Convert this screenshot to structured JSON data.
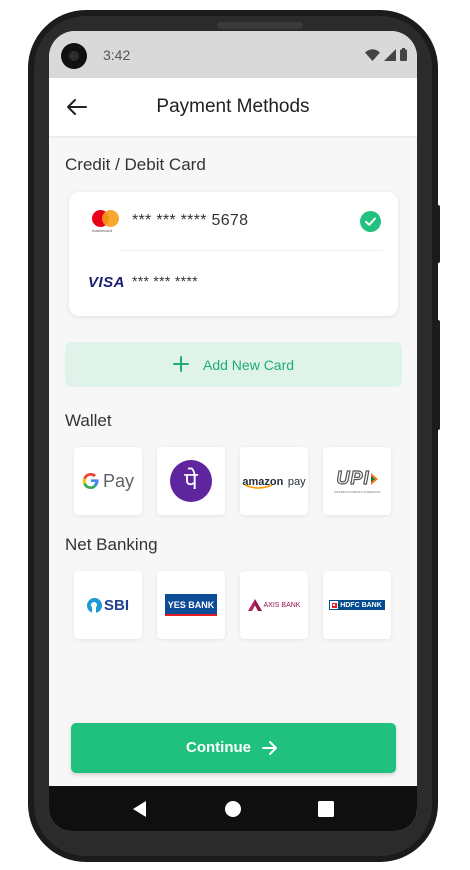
{
  "status_bar": {
    "time": "3:42"
  },
  "app_bar": {
    "title": "Payment Methods"
  },
  "cards_section": {
    "title": "Credit / Debit Card",
    "cards": [
      {
        "brand": "mastercard",
        "brand_caption": "mastercard",
        "number": "*** *** **** 5678",
        "selected": true
      },
      {
        "brand": "VISA",
        "number": "*** *** ****",
        "selected": false
      }
    ],
    "add_card_label": "Add New Card"
  },
  "wallet_section": {
    "title": "Wallet",
    "items": [
      "Google Pay",
      "PhonePe",
      "Amazon Pay",
      "UPI"
    ]
  },
  "wallet_logos": {
    "gpay_text": "Pay",
    "phonepe_glyph": "पे",
    "amazonpay_main": "amazon",
    "amazonpay_suffix": "pay",
    "upi_text": "UPI",
    "upi_caption": "UNIFIED PAYMENTS INTERFACE"
  },
  "netbanking_section": {
    "title": "Net Banking",
    "banks": [
      "SBI",
      "YES BANK",
      "AXIS BANK",
      "HDFC BANK"
    ]
  },
  "continue_button": {
    "label": "Continue"
  },
  "colors": {
    "accent": "#20c07e",
    "accent_light": "#dff3ea",
    "check": "#22c17e"
  }
}
